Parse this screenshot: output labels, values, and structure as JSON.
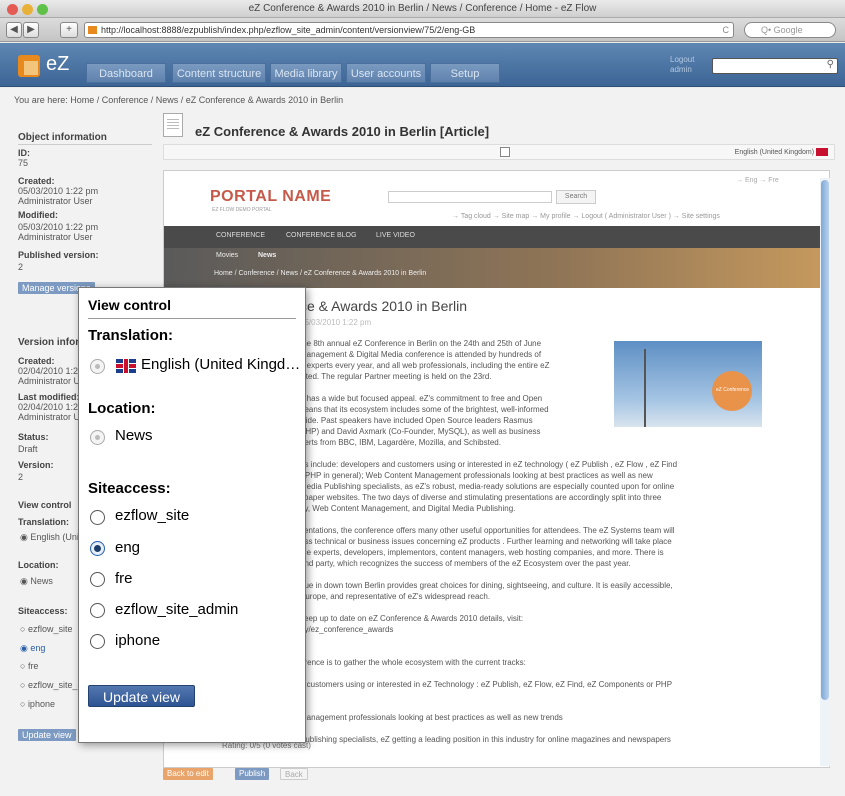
{
  "browser": {
    "title": "eZ Conference & Awards 2010 in Berlin / News / Conference / Home - eZ Flow",
    "back": "◀",
    "forward": "▶",
    "add": "+",
    "url": "http://localhost:8888/ezpublish/index.php/ezflow_site_admin/content/versionview/75/2/eng-GB",
    "reload": "C",
    "google_placeholder": "Q• Google"
  },
  "header": {
    "logo": "eZ",
    "tabs": [
      "Dashboard",
      "Content structure",
      "Media library",
      "User accounts",
      "Setup"
    ],
    "logout": "Logout",
    "user": "admin",
    "search_icon": "magnifier-icon"
  },
  "breadcrumb": "You are here: Home / Conference / News / eZ Conference & Awards 2010 in Berlin",
  "sidebar": {
    "object_info": "Object information",
    "id_label": "ID:",
    "id": "75",
    "created_label": "Created:",
    "created": "05/03/2010 1:22 pm",
    "created_by": "Administrator User",
    "modified_label": "Modified:",
    "modified": "05/03/2010 1:22 pm",
    "modified_by": "Administrator User",
    "published_label": "Published version:",
    "published": "2",
    "manage_button": "Manage versions",
    "version_info": "Version information",
    "v_created_label": "Created:",
    "v_created": "02/04/2010 1:22 pm",
    "v_created_by": "Administrator User",
    "v_modified_label": "Last modified:",
    "v_modified": "02/04/2010 1:22 pm",
    "v_modified_by": "Administrator User",
    "status_label": "Status:",
    "status": "Draft",
    "version_label": "Version:",
    "version": "2",
    "view_control": "View control",
    "translation_label": "Translation:",
    "translation": "English (United Kingdom)",
    "location_label": "Location:",
    "location": "News",
    "siteaccess_label": "Siteaccess:",
    "siteaccess": [
      "ezflow_site",
      "eng",
      "fre",
      "ezflow_site_admin",
      "iphone"
    ],
    "update_button": "Update view"
  },
  "article": {
    "title": "eZ Conference & Awards 2010 in Berlin [Article]",
    "language": "English (United Kingdom)"
  },
  "preview": {
    "portal_name": "PORTAL NAME",
    "portal_sub": "EZ FLOW DEMO PORTAL",
    "search_button": "Search",
    "top_links": "→ Tag cloud  → Site map  → My profile  → Logout ( Administrator User )  → Site settings",
    "lang_links": "→ Eng  → Fre",
    "nav": [
      "CONFERENCE",
      "CONFERENCE BLOG",
      "LIVE VIDEO"
    ],
    "subnav": [
      "Movies",
      "News"
    ],
    "crumb": "Home / Conference / News / eZ Conference & Awards 2010 in Berlin",
    "heading": "ce & Awards 2010 in Berlin",
    "date": "05/03/2010 1:22 pm",
    "lines": [
      "the 8th annual eZ Conference in Berlin on the 24th and 25th of June",
      " Management & Digital Media conference is attended by hundreds of",
      "d experts every year, and all web professionals, including the entire eZ",
      "vited. The regular Partner meeting is held on the 23rd.",
      "",
      "0 has a wide but focused appeal. eZ's commitment to free and Open",
      "neans that its ecosystem includes some of the brightest, well-informed",
      "wide. Past speakers have included Open Source leaders Rasmus",
      "PHP) and David Axmark (Co-Founder, MySQL), as well as business",
      "perts from BBC, IBM, Lagardère, Mozilla, and Schibsted.",
      "",
      "es include: developers and customers using or interested in eZ technology ( eZ Publish , eZ Flow , eZ Find",
      "r PHP in general); Web Content Management professionals looking at best practices as well as new",
      " Media Publishing specialists, as eZ's robust, media-ready solutions are especially counted upon for online",
      "spaper websites. The two days of diverse and stimulating presentations are accordingly split into three",
      "gy, Web Content Management, and Digital Media Publishing.",
      "",
      "sentations, the conference offers many other useful opportunities for attendees. The eZ Systems team will",
      "uss technical or business issues concerning eZ products . Further learning and networking will take place",
      "rce experts, developers, implementors, content managers, web hosting companies, and more. There is",
      " and party, which recognizes the success of members of the eZ Ecosystem over the past year.",
      "",
      "nue in down town Berlin provides great choices for dining, sightseeing, and culture. It is easily accessible,",
      " Europe, and representative of eZ's widespread reach.",
      "",
      "keep up to date on eZ Conference & Awards 2010 details, visit:",
      "ny/ez_conference_awards",
      "0",
      "",
      "erence is to gather the whole ecosystem with the current tracks:",
      "",
      "d customers using or interested in eZ Technology : eZ Publish, eZ Flow, eZ Find, eZ Components or PHP",
      "",
      "",
      " Management professionals looking at best practices as well as new trends",
      "",
      "Publishing specialists, eZ getting a leading position in this industry for online magazines and newspapers"
    ],
    "rating": "Rating: 0/5 (0 votes cast)",
    "image_caption": "eZ Conference"
  },
  "bottom": {
    "back_to_edit": "Back to edit",
    "publish": "Publish",
    "back": "Back"
  }
}
